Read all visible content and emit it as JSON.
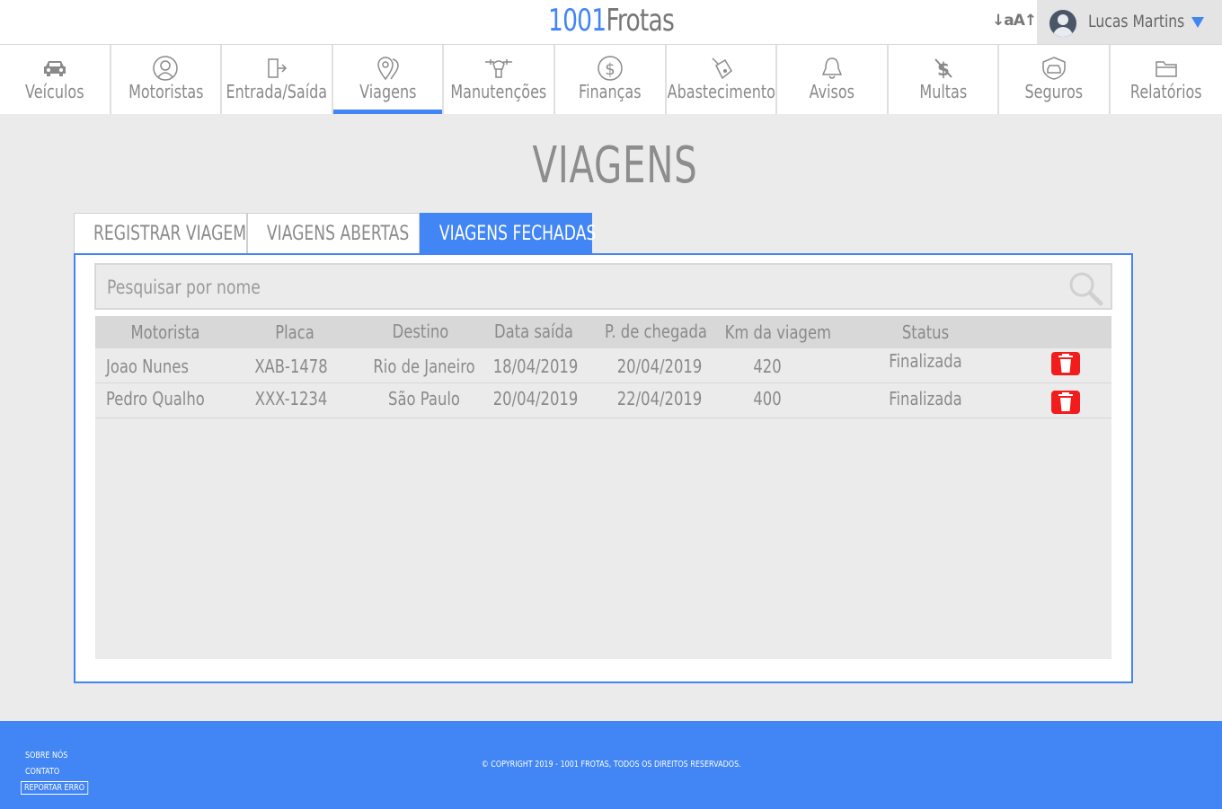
{
  "header": {
    "logo_number": "1001",
    "logo_name": "Frotas",
    "font_size_toggle": "↓aA↑",
    "user_name": "Lucas Martins"
  },
  "nav": [
    {
      "label": "Veículos",
      "icon": "car-icon",
      "active": false
    },
    {
      "label": "Motoristas",
      "icon": "driver-icon",
      "active": false
    },
    {
      "label": "Entrada/Saída",
      "icon": "door-icon",
      "active": false
    },
    {
      "label": "Viagens",
      "icon": "map-pin-icon",
      "active": true
    },
    {
      "label": "Manutenções",
      "icon": "wrench-icon",
      "active": false
    },
    {
      "label": "Finanças",
      "icon": "dollar-icon",
      "active": false
    },
    {
      "label": "Abastecimento",
      "icon": "fuel-icon",
      "active": false
    },
    {
      "label": "Avisos",
      "icon": "bell-icon",
      "active": false
    },
    {
      "label": "Multas",
      "icon": "fine-icon",
      "active": false
    },
    {
      "label": "Seguros",
      "icon": "insurance-icon",
      "active": false
    },
    {
      "label": "Relatórios",
      "icon": "folder-icon",
      "active": false
    }
  ],
  "page_title": "VIAGENS",
  "tabs": [
    {
      "label": "REGISTRAR VIAGEM",
      "active": false
    },
    {
      "label": "VIAGENS ABERTAS",
      "active": false
    },
    {
      "label": "VIAGENS FECHADAS",
      "active": true
    }
  ],
  "search": {
    "placeholder": "Pesquisar por nome"
  },
  "table": {
    "columns": [
      "Motorista",
      "Placa",
      "Destino",
      "Data saída",
      "P. de chegada",
      "Km da viagem",
      "Status"
    ],
    "rows": [
      {
        "motorista": "Joao Nunes",
        "placa": "XAB-1478",
        "destino": "Rio de Janeiro",
        "data_saida": "18/04/2019",
        "chegada": "20/04/2019",
        "km": "420",
        "status": "Finalizada"
      },
      {
        "motorista": "Pedro Qualho",
        "placa": "XXX-1234",
        "destino": "São Paulo",
        "data_saida": "20/04/2019",
        "chegada": "22/04/2019",
        "km": "400",
        "status": "Finalizada"
      }
    ]
  },
  "footer": {
    "about": "SOBRE NÓS",
    "contact": "CONTATO",
    "report": "REPORTAR ERRO",
    "copyright": "© COPYRIGHT 2019 - 1001 FROTAS, TODOS OS DIREITOS RESERVADOS."
  },
  "colors": {
    "accent": "#4285f4",
    "delete": "#f21c1c"
  }
}
